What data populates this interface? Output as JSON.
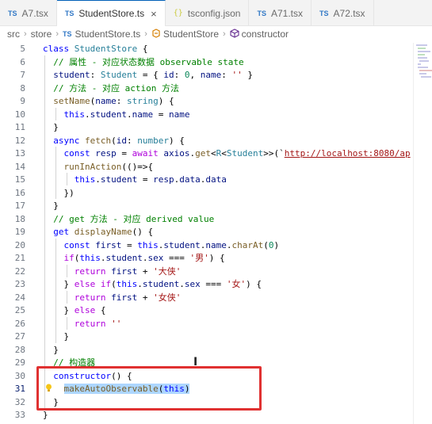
{
  "tabs": [
    {
      "icon": "TS",
      "label": "A7.tsx",
      "active": false
    },
    {
      "icon": "TS",
      "label": "StudentStore.ts",
      "active": true,
      "close": "×"
    },
    {
      "icon": "{}",
      "label": "tsconfig.json",
      "active": false
    },
    {
      "icon": "TS",
      "label": "A71.tsx",
      "active": false
    },
    {
      "icon": "TS",
      "label": "A72.tsx",
      "active": false
    }
  ],
  "breadcrumb": {
    "items": [
      "src",
      "store",
      "StudentStore.ts",
      "StudentStore",
      "constructor"
    ],
    "ts_icon": "TS",
    "separator": "›"
  },
  "lines": [
    {
      "n": "5",
      "tokens": [
        [
          "kw",
          "class "
        ],
        [
          "cls",
          "StudentStore"
        ],
        [
          "pn",
          " {"
        ]
      ]
    },
    {
      "n": "6",
      "tokens": [
        [
          "cm",
          "  // 属性 - 对应状态数据 observable state"
        ]
      ]
    },
    {
      "n": "7",
      "tokens": [
        [
          "vr",
          "  student"
        ],
        [
          "pn",
          ": "
        ],
        [
          "cls",
          "Student"
        ],
        [
          "pn",
          " = { "
        ],
        [
          "vr",
          "id"
        ],
        [
          "pn",
          ": "
        ],
        [
          "num",
          "0"
        ],
        [
          "pn",
          ", "
        ],
        [
          "vr",
          "name"
        ],
        [
          "pn",
          ": "
        ],
        [
          "str",
          "''"
        ],
        [
          "pn",
          " }"
        ]
      ]
    },
    {
      "n": "8",
      "tokens": [
        [
          "cm",
          "  // 方法 - 对应 action 方法"
        ]
      ]
    },
    {
      "n": "9",
      "tokens": [
        [
          "fn",
          "  setName"
        ],
        [
          "pn",
          "("
        ],
        [
          "vr",
          "name"
        ],
        [
          "pn",
          ": "
        ],
        [
          "cls",
          "string"
        ],
        [
          "pn",
          ") {"
        ]
      ]
    },
    {
      "n": "10",
      "tokens": [
        [
          "kw",
          "    this"
        ],
        [
          "pn",
          "."
        ],
        [
          "vr",
          "student"
        ],
        [
          "pn",
          "."
        ],
        [
          "vr",
          "name"
        ],
        [
          "pn",
          " = "
        ],
        [
          "vr",
          "name"
        ]
      ]
    },
    {
      "n": "11",
      "tokens": [
        [
          "pn",
          "  }"
        ]
      ]
    },
    {
      "n": "12",
      "tokens": [
        [
          "kw",
          "  async "
        ],
        [
          "fn",
          "fetch"
        ],
        [
          "pn",
          "("
        ],
        [
          "vr",
          "id"
        ],
        [
          "pn",
          ": "
        ],
        [
          "cls",
          "number"
        ],
        [
          "pn",
          ") {"
        ]
      ]
    },
    {
      "n": "13",
      "tokens": [
        [
          "kw",
          "    const "
        ],
        [
          "vr",
          "resp"
        ],
        [
          "pn",
          " = "
        ],
        [
          "ctl",
          "await "
        ],
        [
          "vr",
          "axios"
        ],
        [
          "pn",
          "."
        ],
        [
          "fn",
          "get"
        ],
        [
          "pn",
          "<"
        ],
        [
          "cls",
          "R"
        ],
        [
          "pn",
          "<"
        ],
        [
          "cls",
          "Student"
        ],
        [
          "pn",
          ">>(`"
        ],
        [
          "url",
          "http://localhost:8080/ap"
        ]
      ]
    },
    {
      "n": "14",
      "tokens": [
        [
          "fn",
          "    runInAction"
        ],
        [
          "pn",
          "(()=>{"
        ]
      ]
    },
    {
      "n": "15",
      "tokens": [
        [
          "kw",
          "      this"
        ],
        [
          "pn",
          "."
        ],
        [
          "vr",
          "student"
        ],
        [
          "pn",
          " = "
        ],
        [
          "vr",
          "resp"
        ],
        [
          "pn",
          "."
        ],
        [
          "vr",
          "data"
        ],
        [
          "pn",
          "."
        ],
        [
          "vr",
          "data"
        ]
      ]
    },
    {
      "n": "16",
      "tokens": [
        [
          "pn",
          "    })"
        ]
      ]
    },
    {
      "n": "17",
      "tokens": [
        [
          "pn",
          "  }"
        ]
      ]
    },
    {
      "n": "18",
      "tokens": [
        [
          "cm",
          "  // get 方法 - 对应 derived value"
        ]
      ]
    },
    {
      "n": "19",
      "tokens": [
        [
          "kw",
          "  get "
        ],
        [
          "fn",
          "displayName"
        ],
        [
          "pn",
          "() {"
        ]
      ]
    },
    {
      "n": "20",
      "tokens": [
        [
          "kw",
          "    const "
        ],
        [
          "vr",
          "first"
        ],
        [
          "pn",
          " = "
        ],
        [
          "kw",
          "this"
        ],
        [
          "pn",
          "."
        ],
        [
          "vr",
          "student"
        ],
        [
          "pn",
          "."
        ],
        [
          "vr",
          "name"
        ],
        [
          "pn",
          "."
        ],
        [
          "fn",
          "charAt"
        ],
        [
          "pn",
          "("
        ],
        [
          "num",
          "0"
        ],
        [
          "pn",
          ")"
        ]
      ]
    },
    {
      "n": "21",
      "tokens": [
        [
          "ctl",
          "    if"
        ],
        [
          "pn",
          "("
        ],
        [
          "kw",
          "this"
        ],
        [
          "pn",
          "."
        ],
        [
          "vr",
          "student"
        ],
        [
          "pn",
          "."
        ],
        [
          "vr",
          "sex"
        ],
        [
          "pn",
          " === "
        ],
        [
          "str",
          "'男'"
        ],
        [
          "pn",
          ") {"
        ]
      ]
    },
    {
      "n": "22",
      "tokens": [
        [
          "ctl",
          "      return "
        ],
        [
          "vr",
          "first"
        ],
        [
          "pn",
          " + "
        ],
        [
          "str",
          "'大侠'"
        ]
      ]
    },
    {
      "n": "23",
      "tokens": [
        [
          "pn",
          "    } "
        ],
        [
          "ctl",
          "else if"
        ],
        [
          "pn",
          "("
        ],
        [
          "kw",
          "this"
        ],
        [
          "pn",
          "."
        ],
        [
          "vr",
          "student"
        ],
        [
          "pn",
          "."
        ],
        [
          "vr",
          "sex"
        ],
        [
          "pn",
          " === "
        ],
        [
          "str",
          "'女'"
        ],
        [
          "pn",
          ") {"
        ]
      ]
    },
    {
      "n": "24",
      "tokens": [
        [
          "ctl",
          "      return "
        ],
        [
          "vr",
          "first"
        ],
        [
          "pn",
          " + "
        ],
        [
          "str",
          "'女侠'"
        ]
      ]
    },
    {
      "n": "25",
      "tokens": [
        [
          "pn",
          "    } "
        ],
        [
          "ctl",
          "else"
        ],
        [
          "pn",
          " {"
        ]
      ]
    },
    {
      "n": "26",
      "tokens": [
        [
          "ctl",
          "      return "
        ],
        [
          "str",
          "''"
        ]
      ]
    },
    {
      "n": "27",
      "tokens": [
        [
          "pn",
          "    }"
        ]
      ]
    },
    {
      "n": "28",
      "tokens": [
        [
          "pn",
          "  }"
        ]
      ]
    },
    {
      "n": "29",
      "tokens": [
        [
          "cm",
          "  // 构造器"
        ]
      ]
    },
    {
      "n": "30",
      "tokens": [
        [
          "kw",
          "  constructor"
        ],
        [
          "pn",
          "() {"
        ]
      ]
    },
    {
      "n": "31",
      "tokens": [
        [
          "pn",
          "    "
        ],
        [
          "fn",
          "makeAutoObservable"
        ],
        [
          "pn",
          "("
        ],
        [
          "kw",
          "this"
        ],
        [
          "pn",
          ")"
        ]
      ],
      "current": true
    },
    {
      "n": "32",
      "tokens": [
        [
          "pn",
          "  }"
        ]
      ]
    },
    {
      "n": "33",
      "tokens": [
        [
          "pn",
          "}"
        ]
      ]
    }
  ],
  "colors": {
    "highlight_box": "#e03131",
    "selection": "#add6ff",
    "active_tab_border": "#005fb8"
  }
}
